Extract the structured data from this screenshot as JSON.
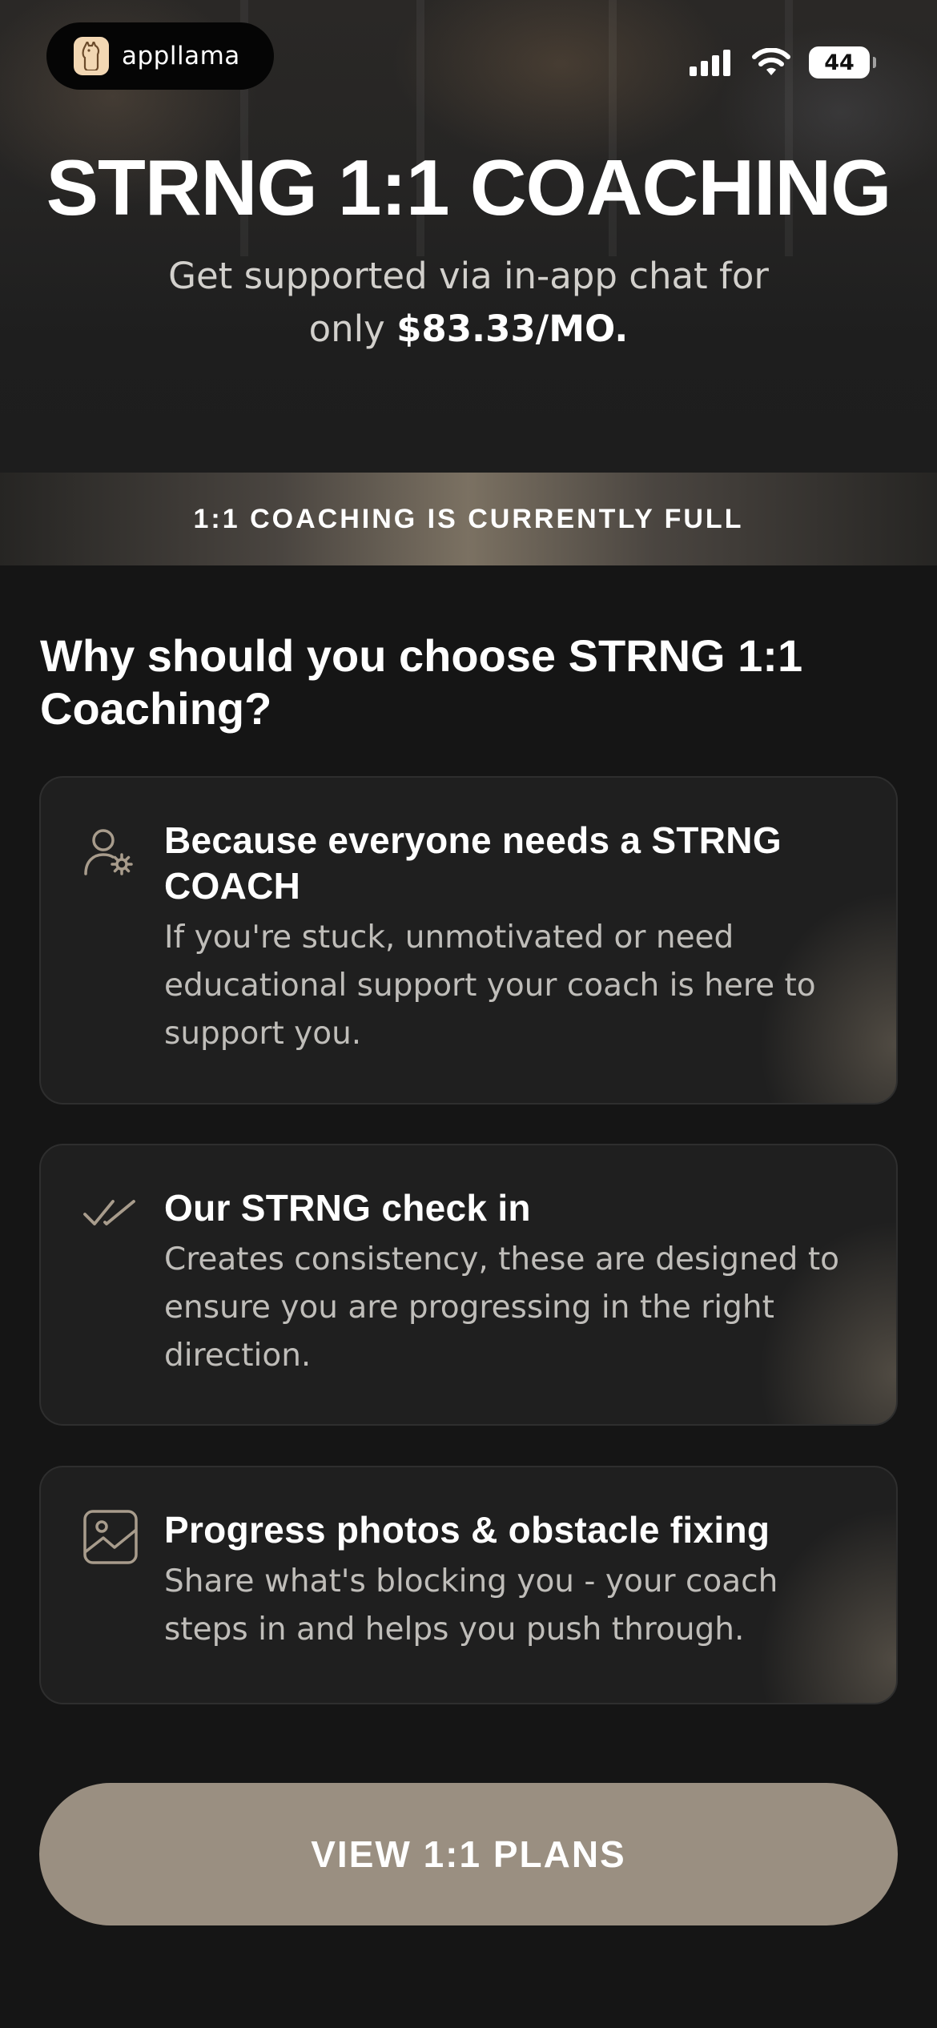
{
  "status_bar": {
    "brand_name": "appllama",
    "battery_level": "44",
    "icons": [
      "appllama-logo-icon",
      "signal-icon",
      "wifi-icon",
      "battery-icon"
    ]
  },
  "hero": {
    "title": "STRNG 1:1 COACHING",
    "subtitle_line1": "Get supported via in-app chat for",
    "subtitle_prefix": "only",
    "price": "$83.33/MO."
  },
  "banner": {
    "text": "1:1 COACHING IS CURRENTLY FULL"
  },
  "why_section": {
    "title": "Why should you choose STRNG 1:1 Coaching?",
    "cards": [
      {
        "icon": "user-gear-icon",
        "title": "Because everyone needs a STRNG COACH",
        "body": "If you're stuck, unmotivated or need educational support your coach is here to support you."
      },
      {
        "icon": "double-check-icon",
        "title": "Our STRNG check in",
        "body": "Creates consistency, these are designed to ensure you are progressing in the right direction."
      },
      {
        "icon": "image-icon",
        "title": "Progress photos & obstacle fixing",
        "body": "Share what's blocking you - your coach steps in and helps you push through."
      }
    ]
  },
  "cta": {
    "label": "VIEW 1:1 PLANS"
  },
  "colors": {
    "background": "#151515",
    "card": "#1f1f1f",
    "accent": "#9a8f81",
    "icon_stroke": "#a89c8c"
  }
}
